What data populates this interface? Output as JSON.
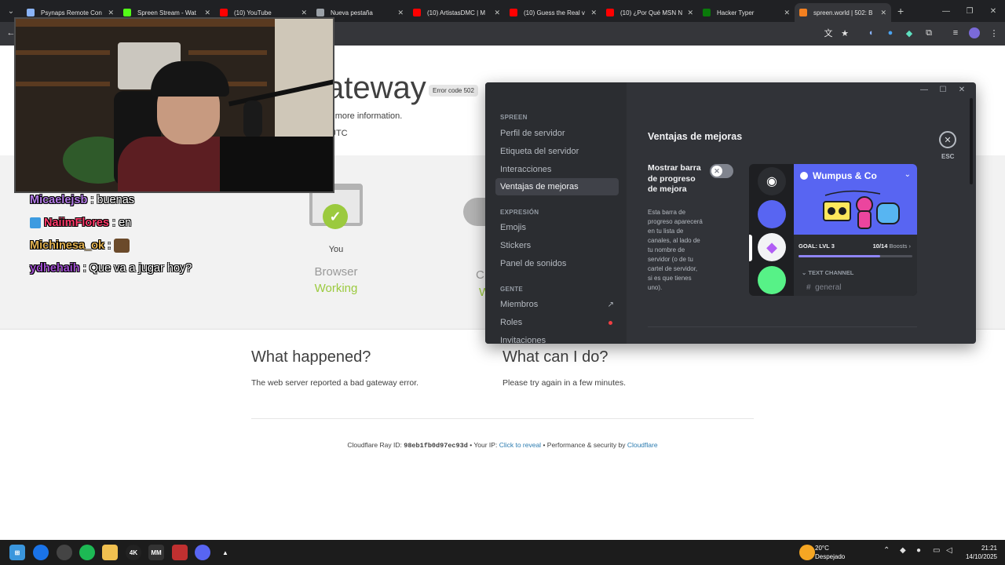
{
  "browser": {
    "tabs": [
      {
        "title": "Psynaps Remote Con",
        "favicon_color": "#8ab4f8"
      },
      {
        "title": "Spreen Stream - Wat",
        "favicon_color": "#53fc18"
      },
      {
        "title": "(10) YouTube",
        "favicon_color": "#ff0000"
      },
      {
        "title": "Nueva pestaña",
        "favicon_color": "#9aa0a6"
      },
      {
        "title": "(10) ArtistasDMC | M",
        "favicon_color": "#ff0000"
      },
      {
        "title": "(10) Guess the Real v",
        "favicon_color": "#ff0000"
      },
      {
        "title": "(10) ¿Por Qué MSN N",
        "favicon_color": "#ff0000"
      },
      {
        "title": "Hacker Typer",
        "favicon_color": "#0a7a0a"
      },
      {
        "title": "spreen.world | 502: B",
        "favicon_color": "#f38020"
      }
    ],
    "active_tab_index": 8
  },
  "cloudflare": {
    "heading": "ateway",
    "error_code": "Error code 502",
    "sub_line1": "r more information.",
    "sub_line2": "UTC",
    "you_label": "You",
    "browser_label": "Browser",
    "browser_status": "Working",
    "partial_label1": "C",
    "partial_label2": "W",
    "what_happened_title": "What happened?",
    "what_happened_text": "The web server reported a bad gateway error.",
    "what_can_i_do_title": "What can I do?",
    "what_can_i_do_text": "Please try again in a few minutes.",
    "footer": {
      "ray_prefix": "Cloudflare Ray ID: ",
      "ray_id": "98eb1fb0d97ec93d",
      "ip_prefix": " • Your IP: ",
      "ip_link": "Click to reveal",
      "perf_prefix": " • Performance & security by ",
      "perf_link": "Cloudflare"
    }
  },
  "chat": {
    "messages": [
      {
        "user": "Micaelejsb",
        "user_color": "#b27be6",
        "text": ": buenas",
        "badge": false,
        "emote": false
      },
      {
        "user": "NaiimFlores",
        "user_color": "#ff3b6b",
        "text": ": en",
        "badge": true,
        "emote": false
      },
      {
        "user": "Michinesa_ok",
        "user_color": "#e0b050",
        "text": ":",
        "badge": false,
        "emote": true
      },
      {
        "user": "ydhehaih",
        "user_color": "#a04fd0",
        "text": ": Que va a jugar hoy?",
        "badge": false,
        "emote": false
      }
    ]
  },
  "discord": {
    "sections": {
      "spreen": "SPREEN",
      "expresion": "EXPRESIÓN",
      "gente": "GENTE"
    },
    "sidebar_items": [
      "Perfil de servidor",
      "Etiqueta del servidor",
      "Interacciones",
      "Ventajas de mejoras",
      "Emojis",
      "Stickers",
      "Panel de sonidos",
      "Miembros",
      "Roles",
      "Invitaciones"
    ],
    "title": "Ventajas de mejoras",
    "esc_label": "ESC",
    "option_title": "Mostrar barra de progreso de mejora",
    "option_desc": "Esta barra de progreso aparecerá en tu lista de canales, al lado de tu nombre de servidor (o de tu cartel de servidor, si es que tienes uno).",
    "toggle_on": false,
    "preview": {
      "server_name": "Wumpus & Co",
      "goal": "GOAL: LVL 3",
      "boosts": "10/14",
      "boosts_suffix": " Boosts",
      "progress": 0.714,
      "text_channel": "TEXT CHANNEL",
      "channel": "general"
    }
  },
  "taskbar": {
    "weather_temp": "20°C",
    "weather_desc": "Despejado",
    "time": "21:21",
    "date": "14/10/2025"
  }
}
